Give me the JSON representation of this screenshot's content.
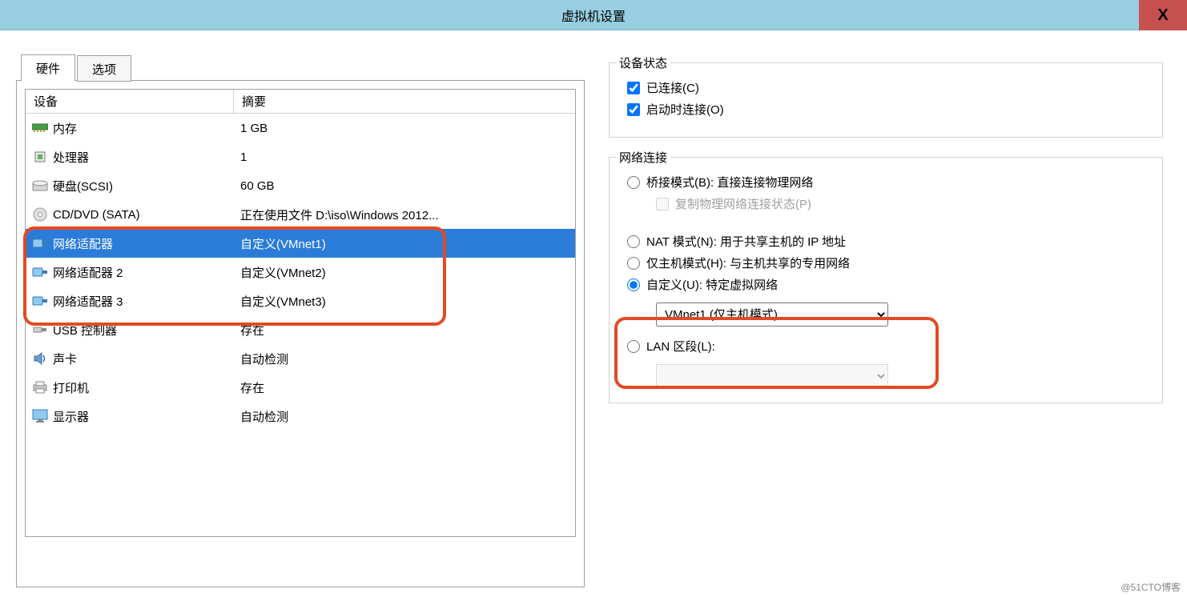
{
  "window": {
    "title": "虚拟机设置",
    "close_icon": "X"
  },
  "tabs": {
    "hardware": "硬件",
    "options": "选项"
  },
  "columns": {
    "device": "设备",
    "summary": "摘要"
  },
  "devices": [
    {
      "icon": "memory",
      "name": "内存",
      "summary": "1 GB",
      "selected": false
    },
    {
      "icon": "cpu",
      "name": "处理器",
      "summary": "1",
      "selected": false
    },
    {
      "icon": "hdd",
      "name": "硬盘(SCSI)",
      "summary": "60 GB",
      "selected": false
    },
    {
      "icon": "cd",
      "name": "CD/DVD (SATA)",
      "summary": "正在使用文件 D:\\iso\\Windows 2012...",
      "selected": false
    },
    {
      "icon": "nic",
      "name": "网络适配器",
      "summary": "自定义(VMnet1)",
      "selected": true
    },
    {
      "icon": "nic",
      "name": "网络适配器 2",
      "summary": "自定义(VMnet2)",
      "selected": false
    },
    {
      "icon": "nic",
      "name": "网络适配器 3",
      "summary": "自定义(VMnet3)",
      "selected": false
    },
    {
      "icon": "usb",
      "name": "USB 控制器",
      "summary": "存在",
      "selected": false
    },
    {
      "icon": "sound",
      "name": "声卡",
      "summary": "自动检测",
      "selected": false
    },
    {
      "icon": "printer",
      "name": "打印机",
      "summary": "存在",
      "selected": false
    },
    {
      "icon": "display",
      "name": "显示器",
      "summary": "自动检测",
      "selected": false
    }
  ],
  "device_state": {
    "legend": "设备状态",
    "connected": "已连接(C)",
    "connect_at_power_on": "启动时连接(O)"
  },
  "network": {
    "legend": "网络连接",
    "bridged": "桥接模式(B): 直接连接物理网络",
    "replicate": "复制物理网络连接状态(P)",
    "nat": "NAT 模式(N): 用于共享主机的 IP 地址",
    "hostonly": "仅主机模式(H): 与主机共享的专用网络",
    "custom": "自定义(U): 特定虚拟网络",
    "custom_selected": "VMnet1 (仅主机模式)",
    "lan_segment": "LAN 区段(L):"
  },
  "watermark": "@51CTO博客"
}
